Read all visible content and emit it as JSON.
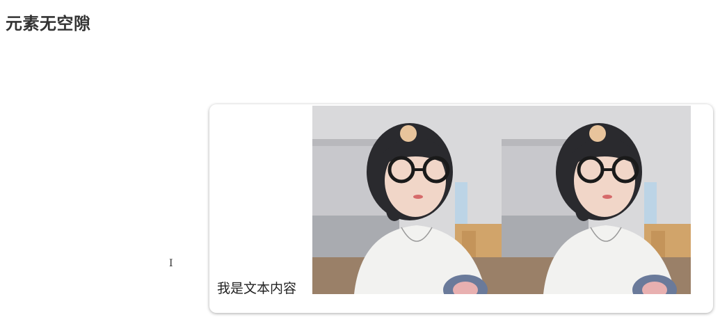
{
  "page": {
    "title": "元素无空隙"
  },
  "cursor": {
    "glyph": "I"
  },
  "card": {
    "text": "我是文本内容",
    "photos": [
      {
        "alt": "portrait-photo"
      },
      {
        "alt": "portrait-photo"
      }
    ]
  }
}
